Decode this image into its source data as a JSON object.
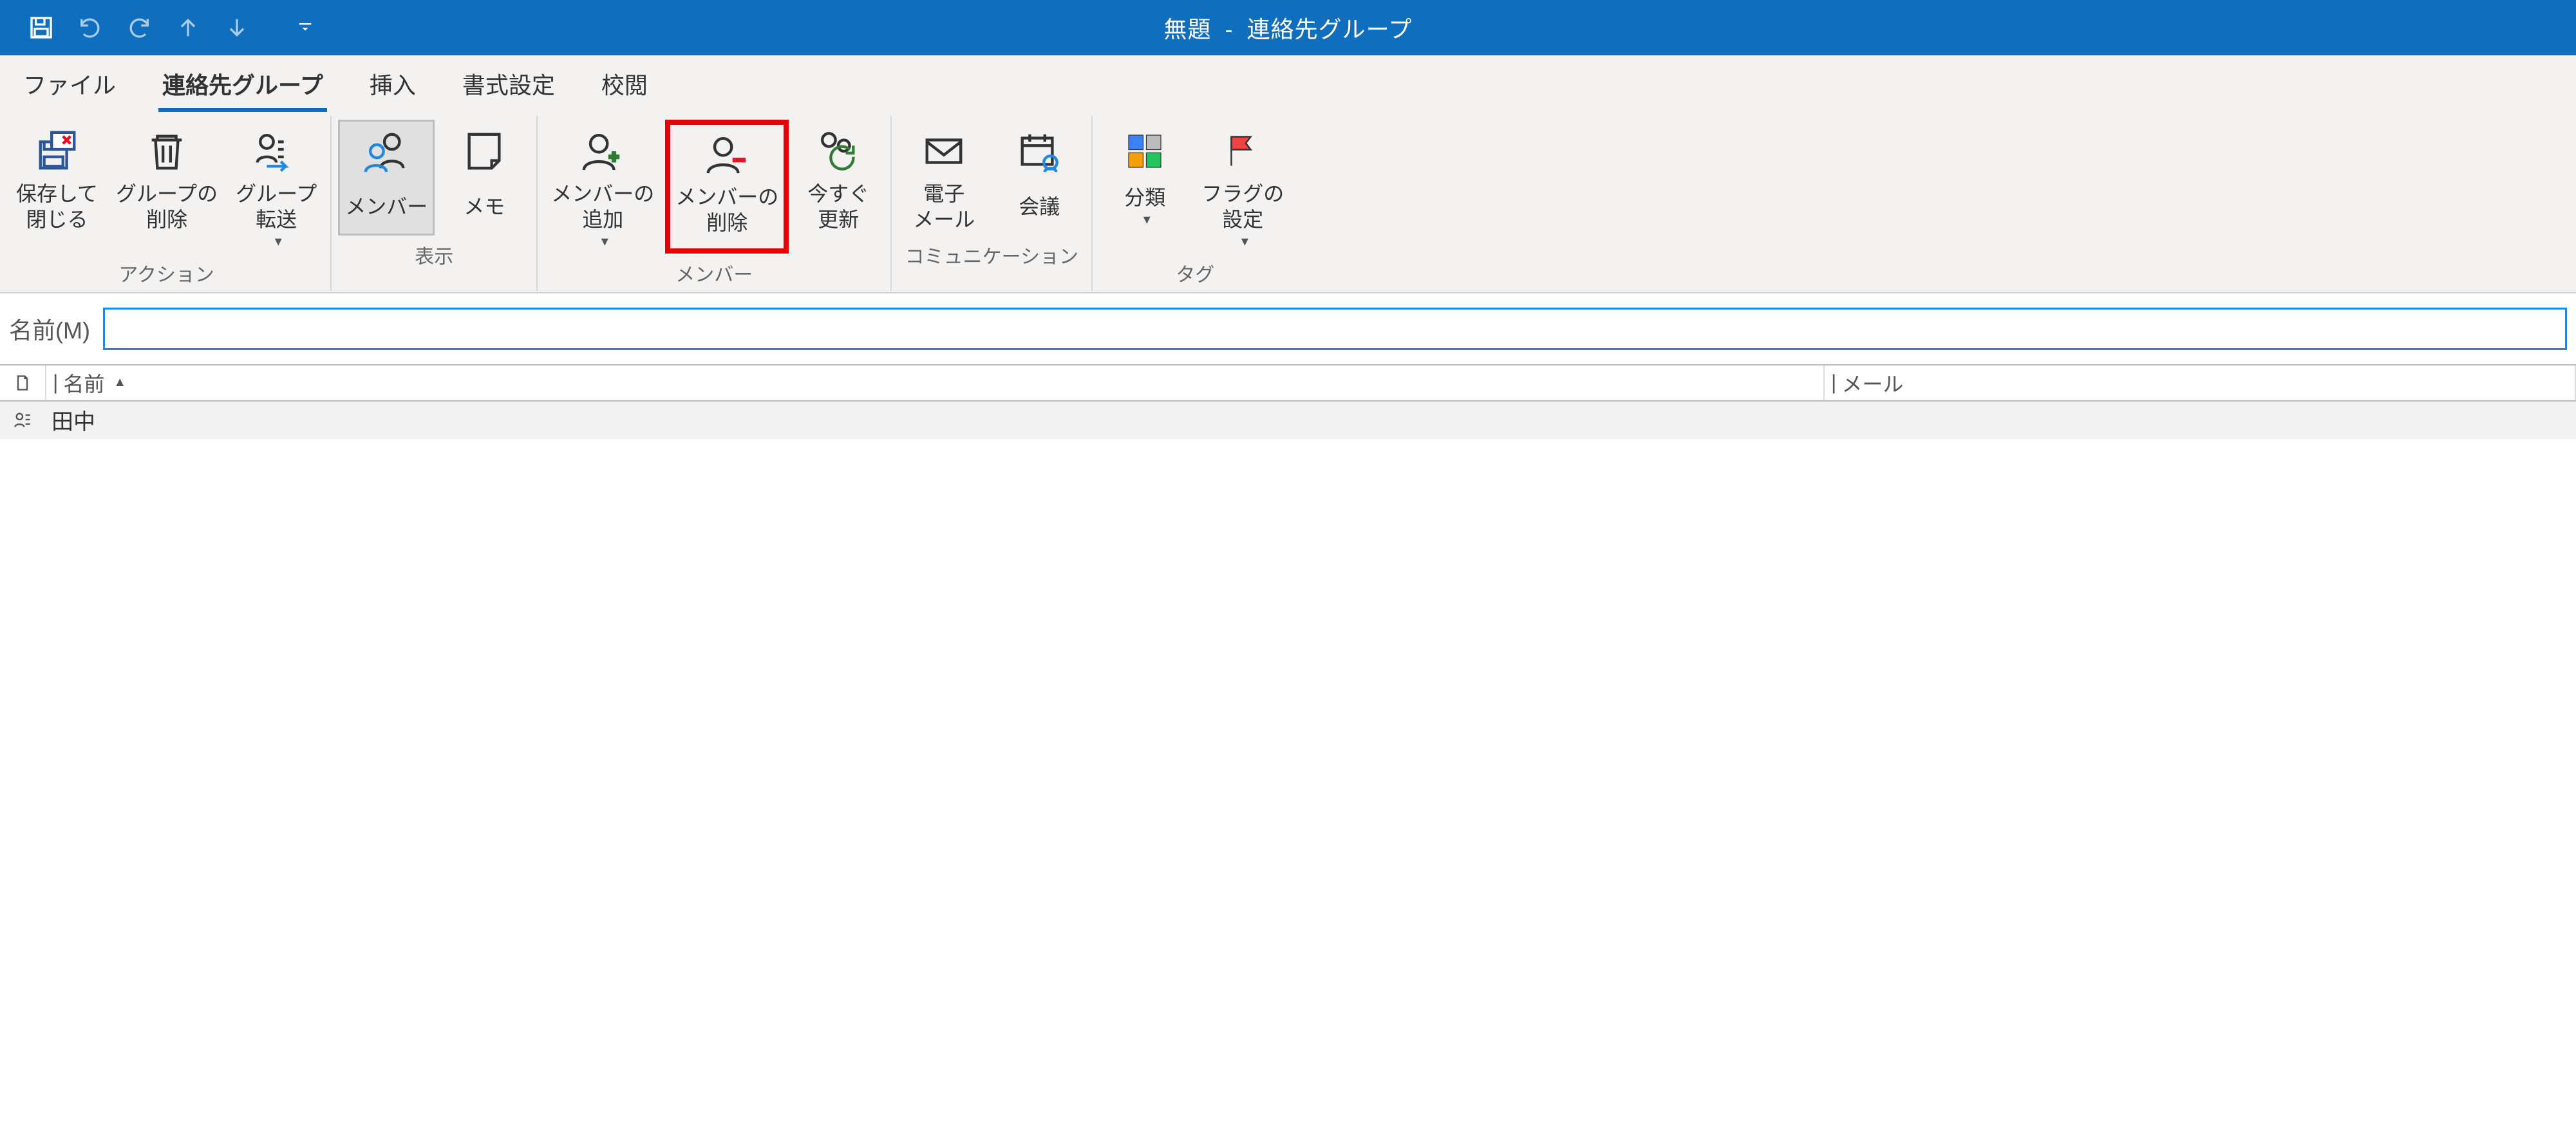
{
  "window": {
    "title_left": "無題",
    "title_sep": "-",
    "title_right": "連絡先グループ"
  },
  "qat": {
    "save": "save-icon",
    "undo": "undo-icon",
    "redo": "redo-icon",
    "up": "arrow-up-icon",
    "down": "arrow-down-icon",
    "customize": "customize-qat-icon"
  },
  "tabs": {
    "file": "ファイル",
    "contact_group": "連絡先グループ",
    "insert": "挿入",
    "format": "書式設定",
    "review": "校閲"
  },
  "ribbon": {
    "groups": {
      "action": {
        "label": "アクション",
        "save_close": "保存して\n閉じる",
        "delete_group": "グループの\n削除",
        "forward_group": "グループ\n転送"
      },
      "show": {
        "label": "表示",
        "members": "メンバー",
        "notes": "メモ"
      },
      "member": {
        "label": "メンバー",
        "add_members": "メンバーの\n追加",
        "remove_member": "メンバーの\n削除",
        "update_now": "今すぐ\n更新"
      },
      "communicate": {
        "label": "コミュニケーション",
        "email": "電子\nメール",
        "meeting": "会議"
      },
      "tags": {
        "label": "タグ",
        "categorize": "分類",
        "follow_up": "フラグの\n設定"
      }
    }
  },
  "name_field": {
    "label": "名前(M)",
    "value": ""
  },
  "list": {
    "columns": {
      "name": "名前",
      "mail": "メール"
    },
    "rows": [
      {
        "icon": "contact-group-icon",
        "name": "田中",
        "mail": ""
      }
    ]
  },
  "colors": {
    "accent": "#106ebe",
    "highlight": "#e60000"
  }
}
